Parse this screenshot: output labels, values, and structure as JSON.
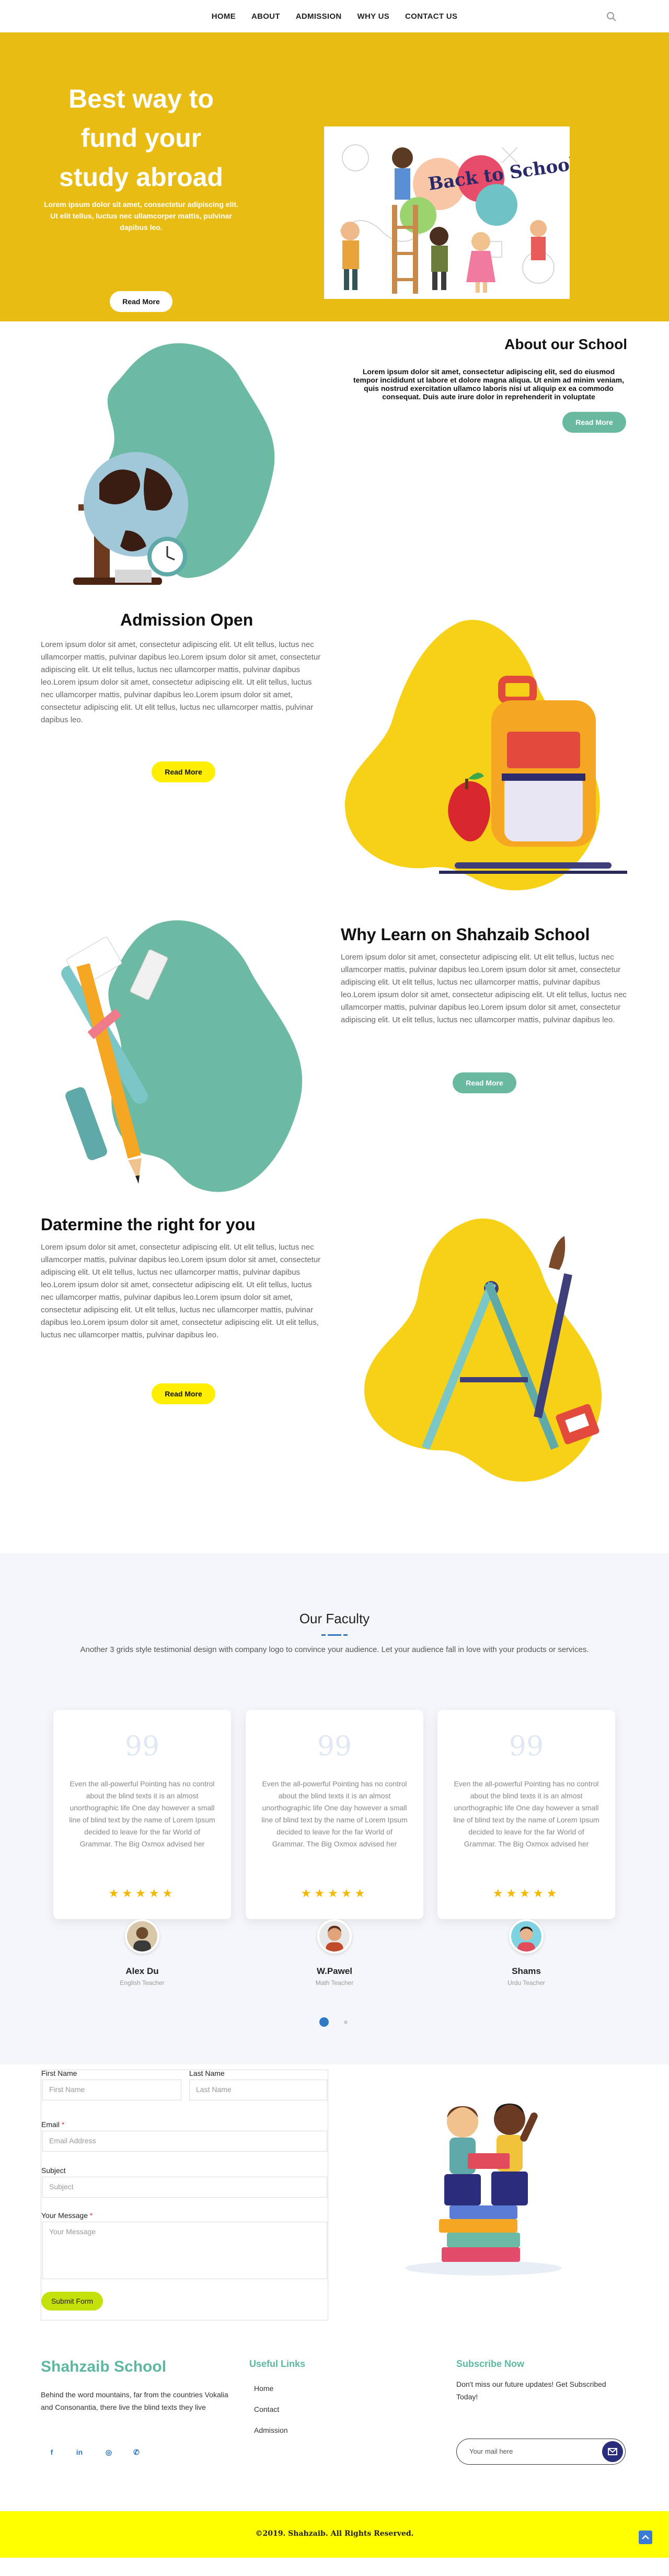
{
  "nav": {
    "items": [
      "HOME",
      "ABOUT",
      "ADMISSION",
      "WHY US",
      "CONTACT US"
    ]
  },
  "hero": {
    "title": "Best way to fund your study abroad",
    "subtitle": "Lorem ipsum dolor sit amet, consectetur adipiscing elit. Ut elit tellus, luctus nec ullamcorper mattis, pulvinar dapibus leo.",
    "button": "Read More",
    "image_text": "Back to School!"
  },
  "about": {
    "title": "About our School",
    "text": "Lorem ipsum dolor sit amet, consectetur adipiscing elit, sed do eiusmod tempor incididunt ut labore et dolore magna aliqua. Ut enim ad minim veniam, quis nostrud exercitation ullamco laboris nisi ut aliquip ex ea commodo consequat. Duis aute irure dolor in reprehenderit in voluptate",
    "button": "Read More"
  },
  "admission": {
    "title": "Admission Open",
    "text": "Lorem ipsum dolor sit amet, consectetur adipiscing elit. Ut elit tellus, luctus nec ullamcorper mattis, pulvinar dapibus leo.Lorem ipsum dolor sit amet, consectetur adipiscing elit. Ut elit tellus, luctus nec ullamcorper mattis, pulvinar dapibus leo.Lorem ipsum dolor sit amet, consectetur adipiscing elit. Ut elit tellus, luctus nec ullamcorper mattis, pulvinar dapibus leo.Lorem ipsum dolor sit amet, consectetur adipiscing elit. Ut elit tellus, luctus nec ullamcorper mattis, pulvinar dapibus leo.",
    "button": "Read More"
  },
  "why": {
    "title": "Why Learn on Shahzaib School",
    "text": "Lorem ipsum dolor sit amet, consectetur adipiscing elit. Ut elit tellus, luctus nec ullamcorper mattis, pulvinar dapibus leo.Lorem ipsum dolor sit amet, consectetur adipiscing elit. Ut elit tellus, luctus nec ullamcorper mattis, pulvinar dapibus leo.Lorem ipsum dolor sit amet, consectetur adipiscing elit. Ut elit tellus, luctus nec ullamcorper mattis, pulvinar dapibus leo.Lorem ipsum dolor sit amet, consectetur adipiscing elit. Ut elit tellus, luctus nec ullamcorper mattis, pulvinar dapibus leo.",
    "button": "Read More"
  },
  "determine": {
    "title": "Datermine the right for you",
    "text": "Lorem ipsum dolor sit amet, consectetur adipiscing elit. Ut elit tellus, luctus nec ullamcorper mattis, pulvinar dapibus leo.Lorem ipsum dolor sit amet, consectetur adipiscing elit. Ut elit tellus, luctus nec ullamcorper mattis, pulvinar dapibus leo.Lorem ipsum dolor sit amet, consectetur adipiscing elit. Ut elit tellus, luctus nec ullamcorper mattis, pulvinar dapibus leo.Lorem ipsum dolor sit amet, consectetur adipiscing elit. Ut elit tellus, luctus nec ullamcorper mattis, pulvinar dapibus leo.Lorem ipsum dolor sit amet, consectetur adipiscing elit. Ut elit tellus, luctus nec ullamcorper mattis, pulvinar dapibus leo.",
    "button": "Read More"
  },
  "faculty": {
    "title": "Our Faculty",
    "description": "Another 3 grids style testimonial design with company logo to convince your audience. Let your audience fall in love with your products or services.",
    "quote_mark": "99",
    "members": [
      {
        "text": "Even the all-powerful Pointing has no control about the blind texts it is an almost unorthographic life One day however a small line of blind text by the name of Lorem Ipsum decided to leave for the far World of Grammar. The Big Oxmox advised her",
        "stars": "★★★★★",
        "name": "Alex Du",
        "role": "English Teacher"
      },
      {
        "text": "Even the all-powerful Pointing has no control about the blind texts it is an almost unorthographic life One day however a small line of blind text by the name of Lorem Ipsum decided to leave for the far World of Grammar. The Big Oxmox advised her",
        "stars": "★★★★★",
        "name": "W.Pawel",
        "role": "Math Teacher"
      },
      {
        "text": "Even the all-powerful Pointing has no control about the blind texts it is an almost unorthographic life One day however a small line of blind text by the name of Lorem Ipsum decided to leave for the far World of Grammar. The Big Oxmox advised her",
        "stars": "★★★★★",
        "name": "Shams",
        "role": "Urdu Teacher"
      }
    ]
  },
  "form": {
    "first_name_label": "First Name",
    "first_name_placeholder": "First Name",
    "last_name_label": "Last Name",
    "last_name_placeholder": "Last Name",
    "email_label": "Email",
    "email_placeholder": "Email Address",
    "subject_label": "Subject",
    "subject_placeholder": "Subject",
    "message_label": "Your Message",
    "message_placeholder": "Your Message",
    "required_mark": "*",
    "submit": "Submit Form"
  },
  "footer": {
    "brand": "Shahzaib School",
    "about_text": "Behind the word mountains, far from the countries Vokalia and Consonantia, there live the blind texts they live",
    "social": [
      "f",
      "in",
      "◎",
      "✆"
    ],
    "links_title": "Useful Links",
    "links": [
      "Home",
      "Contact",
      "Admission"
    ],
    "subscribe_title": "Subscribe Now",
    "subscribe_text": "Don't miss our future updates! Get Subscribed Today!",
    "email_placeholder": "Your mail here",
    "copyright": "©2019. Shahzaib. All Rights Reserved."
  },
  "colors": {
    "hero_bg": "#e9bc13",
    "accent_green": "#68b9a0",
    "accent_yellow": "#ffee00",
    "footer_bar": "#ffff00",
    "star": "#f5b800"
  }
}
